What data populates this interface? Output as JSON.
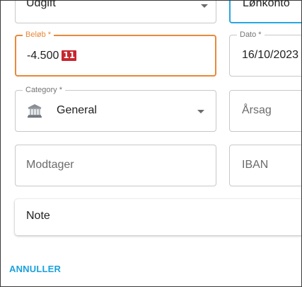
{
  "form": {
    "account_type": {
      "value": "Udgift"
    },
    "account": {
      "value": "Lønkonto"
    },
    "amount": {
      "label": "Beløb *",
      "value": "-4.500",
      "badge": "11"
    },
    "date": {
      "label": "Dato *",
      "value": "16/10/2023"
    },
    "category": {
      "label": "Category *",
      "value": "General",
      "icon": "bank-icon"
    },
    "reason": {
      "placeholder": "Årsag"
    },
    "recipient": {
      "placeholder": "Modtager"
    },
    "iban": {
      "placeholder": "IBAN"
    },
    "note": {
      "placeholder": "Note"
    }
  },
  "actions": {
    "cancel_label": "ANNULLER"
  },
  "colors": {
    "focus": "#e8893a",
    "accent": "#2aa6e0",
    "badge": "#c8262f",
    "link": "#1ba1dc"
  }
}
